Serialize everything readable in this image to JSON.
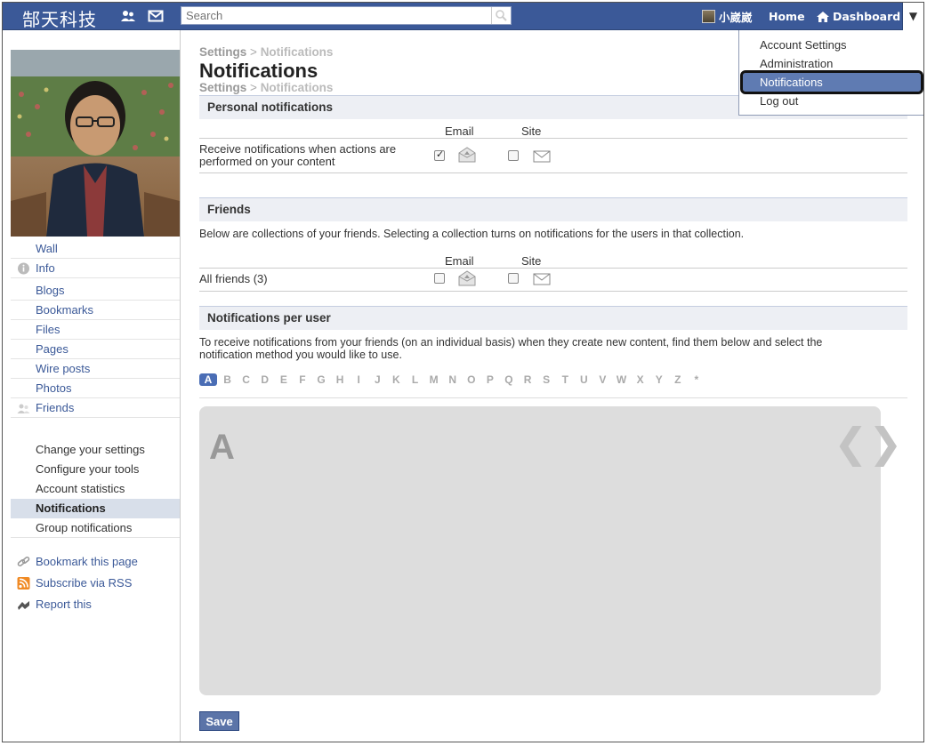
{
  "header": {
    "logo": "郜天科技",
    "search_placeholder": "Search",
    "user_name": "小崴崴",
    "home": "Home",
    "dashboard": "Dashboard",
    "menu_toggle": "▼"
  },
  "dropdown": {
    "items": [
      {
        "label": "Account Settings"
      },
      {
        "label": "Administration"
      },
      {
        "label": "Notifications"
      },
      {
        "label": "Log out"
      }
    ]
  },
  "sidebar": {
    "profile_items": [
      {
        "label": "Wall"
      },
      {
        "label": "Info"
      },
      {
        "label": "Blogs"
      },
      {
        "label": "Bookmarks"
      },
      {
        "label": "Files"
      },
      {
        "label": "Pages"
      },
      {
        "label": "Wire posts"
      },
      {
        "label": "Photos"
      },
      {
        "label": "Friends"
      }
    ],
    "settings_items": [
      {
        "label": "Change your settings"
      },
      {
        "label": "Configure your tools"
      },
      {
        "label": "Account statistics"
      },
      {
        "label": "Notifications"
      },
      {
        "label": "Group notifications"
      }
    ],
    "extras": [
      {
        "label": "Bookmark this page"
      },
      {
        "label": "Subscribe via RSS"
      },
      {
        "label": "Report this"
      }
    ]
  },
  "main": {
    "breadcrumb_root": "Settings",
    "breadcrumb_sep": ">",
    "breadcrumb_current": "Notifications",
    "title": "Notifications",
    "personal": {
      "heading": "Personal notifications",
      "email_label": "Email",
      "site_label": "Site",
      "row_label_line1": "Receive notifications when actions are",
      "row_label_line2": "performed on your content"
    },
    "friends": {
      "heading": "Friends",
      "description": "Below are collections of your friends. Selecting a collection turns on notifications for the users in that collection.",
      "email_label": "Email",
      "site_label": "Site",
      "row_label": "All friends (3)"
    },
    "per_user": {
      "heading": "Notifications per user",
      "description_line1": "To receive notifications from your friends (on an individual basis) when they create new content, find them below and select the",
      "description_line2": "notification method you would like to use.",
      "letters": [
        "A",
        "B",
        "C",
        "D",
        "E",
        "F",
        "G",
        "H",
        "I",
        "J",
        "K",
        "L",
        "M",
        "N",
        "O",
        "P",
        "Q",
        "R",
        "S",
        "T",
        "U",
        "V",
        "W",
        "X",
        "Y",
        "Z",
        "*"
      ],
      "selected_letter": "A",
      "box_letter": "A",
      "prev": "❮",
      "next": "❯"
    },
    "save_label": "Save"
  },
  "colors": {
    "brand": "#3b5998",
    "accent": "#5f7bb2"
  }
}
